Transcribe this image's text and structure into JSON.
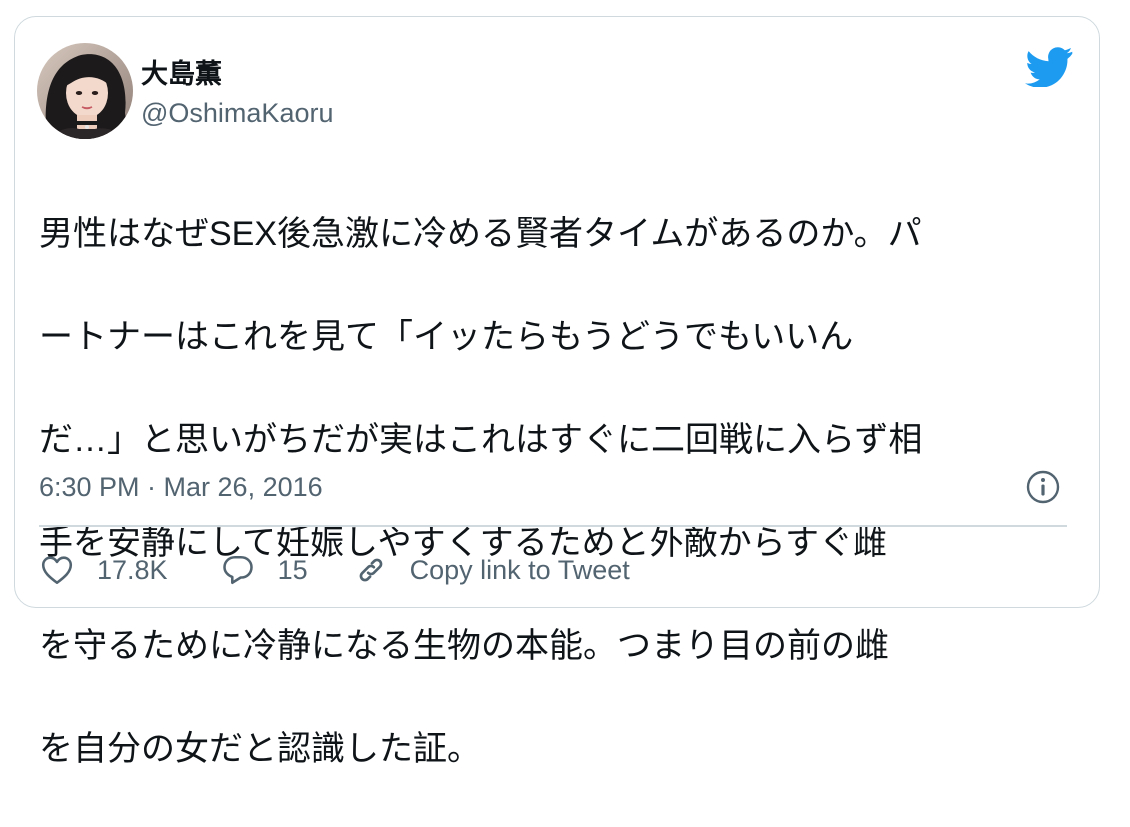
{
  "tweet": {
    "author": {
      "display_name": "大島薫",
      "handle": "@OshimaKaoru"
    },
    "text_lines": [
      "男性はなぜSEX後急激に冷める賢者タイムがあるのか。パ",
      "ートナーはこれを見て「イッたらもうどうでもいいん",
      "だ…」と思いがちだが実はこれはすぐに二回戦に入らず相",
      "手を安静にして妊娠しやすくするためと外敵からすぐ雌",
      "を守るために冷静になる生物の本能。つまり目の前の雌",
      "を自分の女だと認識した証。"
    ],
    "timestamp": "6:30 PM · Mar 26, 2016"
  },
  "actions": {
    "like_count": "17.8K",
    "reply_count": "15",
    "copy_link_label": "Copy link to Tweet"
  },
  "icons": {
    "brand": "twitter-bird-icon",
    "info": "info-icon",
    "like": "heart-icon",
    "reply": "speech-bubble-icon",
    "link": "chain-link-icon"
  },
  "colors": {
    "brand": "#1d9bf0",
    "text": "#0f1419",
    "secondary_text": "#536471",
    "border": "#cfd9de"
  }
}
